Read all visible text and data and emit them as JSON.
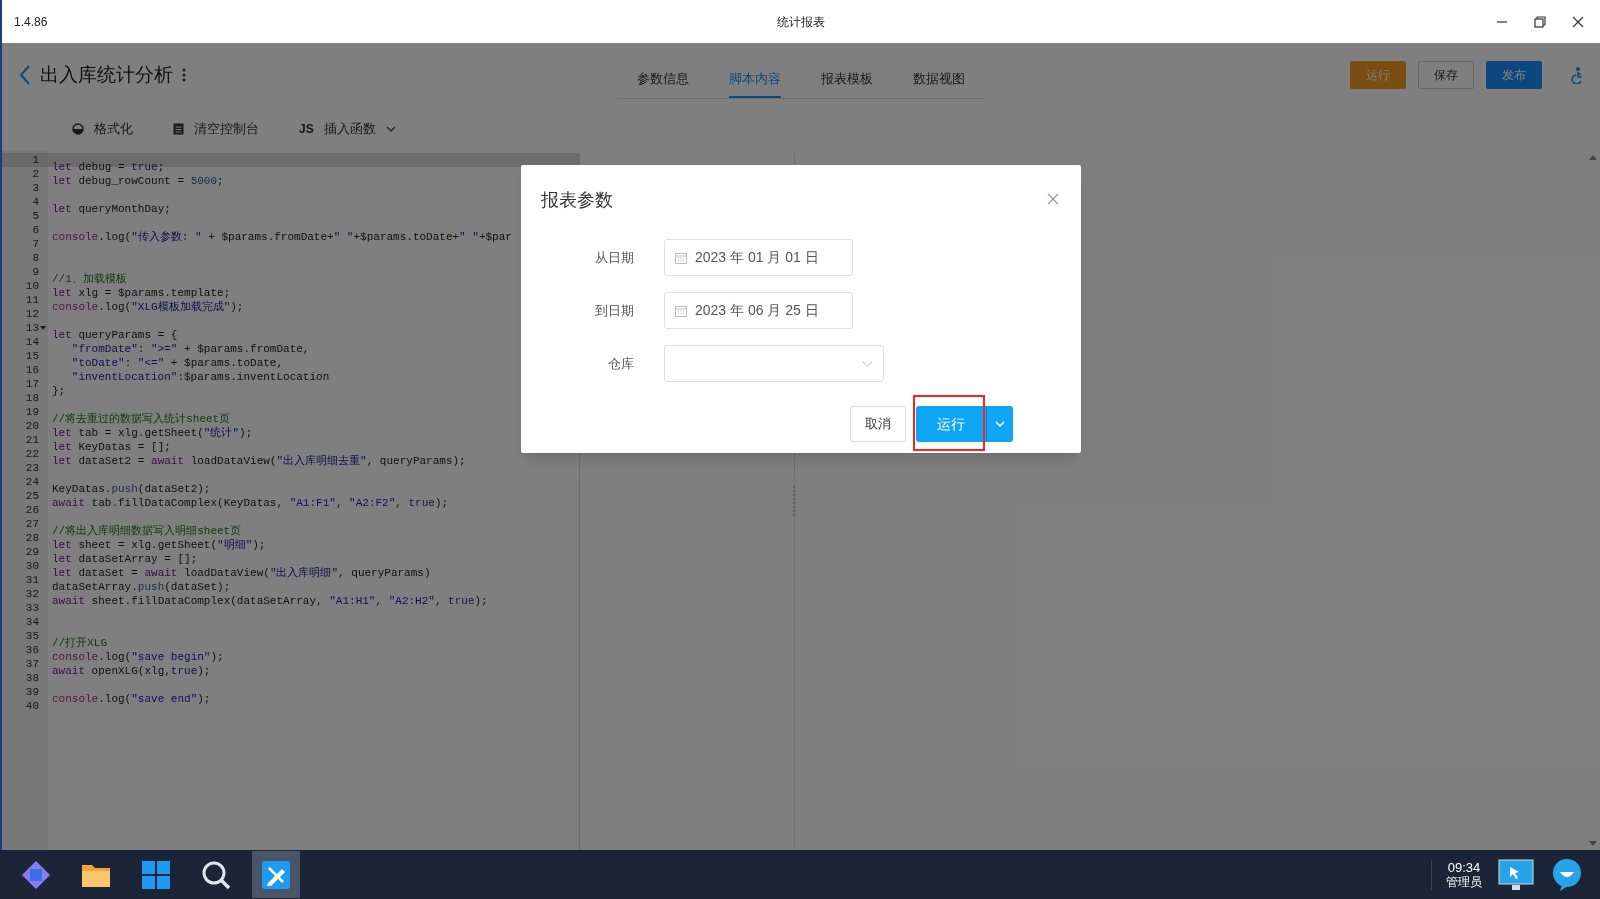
{
  "window": {
    "version": "1.4.86",
    "title": "统计报表"
  },
  "header": {
    "title": "出入库统计分析",
    "tabs": [
      {
        "label": "参数信息",
        "selected": false
      },
      {
        "label": "脚本内容",
        "selected": true
      },
      {
        "label": "报表模板",
        "selected": false
      },
      {
        "label": "数据视图",
        "selected": false
      }
    ],
    "buttons": [
      {
        "kind": "run",
        "label": "运行"
      },
      {
        "kind": "save",
        "label": "保存"
      },
      {
        "kind": "publish",
        "label": "发布"
      }
    ]
  },
  "toolbar": [
    {
      "kind": "format",
      "label": "格式化"
    },
    {
      "kind": "clear",
      "label": "清空控制台"
    },
    {
      "kind": "insert",
      "prefix": "JS",
      "label": "插入函数"
    }
  ],
  "code": [
    {
      "n": "1",
      "fold": false,
      "active": true,
      "tokens": [
        {
          "kind": "kw",
          "t": "let"
        },
        {
          "kind": "p",
          "t": " debug = "
        },
        {
          "kind": "atom",
          "t": "true"
        },
        {
          "kind": "p",
          "t": ";"
        }
      ]
    },
    {
      "n": "2",
      "fold": false,
      "active": false,
      "tokens": [
        {
          "kind": "kw",
          "t": "let"
        },
        {
          "kind": "p",
          "t": " debug_rowCount = "
        },
        {
          "kind": "num",
          "t": "5000"
        },
        {
          "kind": "p",
          "t": ";"
        }
      ]
    },
    {
      "n": "3",
      "fold": false,
      "active": false
    },
    {
      "n": "4",
      "fold": false,
      "active": false,
      "tokens": [
        {
          "kind": "kw",
          "t": "let"
        },
        {
          "kind": "p",
          "t": " queryMonthDay;"
        }
      ]
    },
    {
      "n": "5",
      "fold": false,
      "active": false
    },
    {
      "n": "6",
      "fold": false,
      "active": false,
      "tokens": [
        {
          "kind": "builtin",
          "t": "console"
        },
        {
          "kind": "p",
          "t": ".log("
        },
        {
          "kind": "str",
          "t": "\"传入参数: \""
        },
        {
          "kind": "p",
          "t": " + $params.fromDate+"
        },
        {
          "kind": "str",
          "t": "\" \""
        },
        {
          "kind": "p",
          "t": "+$params.toDate+"
        },
        {
          "kind": "str",
          "t": "\" \""
        },
        {
          "kind": "p",
          "t": "+$par"
        }
      ]
    },
    {
      "n": "7",
      "fold": false,
      "active": false
    },
    {
      "n": "8",
      "fold": false,
      "active": false
    },
    {
      "n": "9",
      "fold": false,
      "active": false,
      "tokens": [
        {
          "kind": "com",
          "t": "//1、加载模板"
        }
      ]
    },
    {
      "n": "10",
      "fold": false,
      "active": false,
      "tokens": [
        {
          "kind": "kw",
          "t": "let"
        },
        {
          "kind": "p",
          "t": " xlg = $params.template;"
        }
      ]
    },
    {
      "n": "11",
      "fold": false,
      "active": false,
      "tokens": [
        {
          "kind": "builtin",
          "t": "console"
        },
        {
          "kind": "p",
          "t": ".log("
        },
        {
          "kind": "str",
          "t": "\"XLG模板加载完成\""
        },
        {
          "kind": "p",
          "t": ");"
        }
      ]
    },
    {
      "n": "12",
      "fold": false,
      "active": false
    },
    {
      "n": "13",
      "fold": true,
      "active": false,
      "tokens": [
        {
          "kind": "kw",
          "t": "let"
        },
        {
          "kind": "p",
          "t": " queryParams = {"
        }
      ]
    },
    {
      "n": "14",
      "fold": false,
      "active": false,
      "tokens": [
        {
          "kind": "str",
          "t": "   \"fromDate\""
        },
        {
          "kind": "p",
          "t": ": "
        },
        {
          "kind": "str",
          "t": "\">=\""
        },
        {
          "kind": "p",
          "t": " + $params.fromDate,"
        }
      ]
    },
    {
      "n": "15",
      "fold": false,
      "active": false,
      "tokens": [
        {
          "kind": "str",
          "t": "   \"toDate\""
        },
        {
          "kind": "p",
          "t": ": "
        },
        {
          "kind": "str",
          "t": "\"<=\""
        },
        {
          "kind": "p",
          "t": " + $params.toDate,"
        }
      ]
    },
    {
      "n": "16",
      "fold": false,
      "active": false,
      "tokens": [
        {
          "kind": "str",
          "t": "   \"inventLocation\""
        },
        {
          "kind": "p",
          "t": ":$params.inventLocation"
        }
      ]
    },
    {
      "n": "17",
      "fold": false,
      "active": false,
      "tokens": [
        {
          "kind": "p",
          "t": "};"
        }
      ]
    },
    {
      "n": "18",
      "fold": false,
      "active": false
    },
    {
      "n": "19",
      "fold": false,
      "active": false,
      "tokens": [
        {
          "kind": "com",
          "t": "//将去重过的数据写入统计sheet页"
        }
      ]
    },
    {
      "n": "20",
      "fold": false,
      "active": false,
      "tokens": [
        {
          "kind": "kw",
          "t": "let"
        },
        {
          "kind": "p",
          "t": " tab = xlg.getSheet("
        },
        {
          "kind": "str",
          "t": "\"统计\""
        },
        {
          "kind": "p",
          "t": ");"
        }
      ]
    },
    {
      "n": "21",
      "fold": false,
      "active": false,
      "tokens": [
        {
          "kind": "kw",
          "t": "let"
        },
        {
          "kind": "p",
          "t": " KeyDatas = [];"
        }
      ]
    },
    {
      "n": "22",
      "fold": false,
      "active": false,
      "tokens": [
        {
          "kind": "kw",
          "t": "let"
        },
        {
          "kind": "p",
          "t": " dataSet2 = "
        },
        {
          "kind": "kw",
          "t": "await"
        },
        {
          "kind": "p",
          "t": " loadDataView("
        },
        {
          "kind": "str",
          "t": "\"出入库明细去重\""
        },
        {
          "kind": "p",
          "t": ", queryParams);"
        }
      ]
    },
    {
      "n": "23",
      "fold": false,
      "active": false
    },
    {
      "n": "24",
      "fold": false,
      "active": false,
      "tokens": [
        {
          "kind": "p",
          "t": "KeyDatas."
        },
        {
          "kind": "prop",
          "t": "push"
        },
        {
          "kind": "p",
          "t": "(dataSet2);"
        }
      ]
    },
    {
      "n": "25",
      "fold": false,
      "active": false,
      "tokens": [
        {
          "kind": "kw",
          "t": "await"
        },
        {
          "kind": "p",
          "t": " tab.fillDataComplex(KeyDatas, "
        },
        {
          "kind": "str",
          "t": "\"A1:F1\""
        },
        {
          "kind": "p",
          "t": ", "
        },
        {
          "kind": "str",
          "t": "\"A2:F2\""
        },
        {
          "kind": "p",
          "t": ", "
        },
        {
          "kind": "atom",
          "t": "true"
        },
        {
          "kind": "p",
          "t": ");"
        }
      ]
    },
    {
      "n": "26",
      "fold": false,
      "active": false
    },
    {
      "n": "27",
      "fold": false,
      "active": false,
      "tokens": [
        {
          "kind": "com",
          "t": "//将出入库明细数据写入明细sheet页"
        }
      ]
    },
    {
      "n": "28",
      "fold": false,
      "active": false,
      "tokens": [
        {
          "kind": "kw",
          "t": "let"
        },
        {
          "kind": "p",
          "t": " sheet = xlg.getSheet("
        },
        {
          "kind": "str",
          "t": "\"明细\""
        },
        {
          "kind": "p",
          "t": ");"
        }
      ]
    },
    {
      "n": "29",
      "fold": false,
      "active": false,
      "tokens": [
        {
          "kind": "kw",
          "t": "let"
        },
        {
          "kind": "p",
          "t": " dataSetArray = [];"
        }
      ]
    },
    {
      "n": "30",
      "fold": false,
      "active": false,
      "tokens": [
        {
          "kind": "kw",
          "t": "let"
        },
        {
          "kind": "p",
          "t": " dataSet = "
        },
        {
          "kind": "kw",
          "t": "await"
        },
        {
          "kind": "p",
          "t": " loadDataView("
        },
        {
          "kind": "str",
          "t": "\"出入库明细\""
        },
        {
          "kind": "p",
          "t": ", queryParams)"
        }
      ]
    },
    {
      "n": "31",
      "fold": false,
      "active": false,
      "tokens": [
        {
          "kind": "p",
          "t": "dataSetArray."
        },
        {
          "kind": "prop",
          "t": "push"
        },
        {
          "kind": "p",
          "t": "(dataSet);"
        }
      ]
    },
    {
      "n": "32",
      "fold": false,
      "active": false,
      "tokens": [
        {
          "kind": "kw",
          "t": "await"
        },
        {
          "kind": "p",
          "t": " sheet.fillDataComplex(dataSetArray, "
        },
        {
          "kind": "str",
          "t": "\"A1:H1\""
        },
        {
          "kind": "p",
          "t": ", "
        },
        {
          "kind": "str",
          "t": "\"A2:H2\""
        },
        {
          "kind": "p",
          "t": ", "
        },
        {
          "kind": "atom",
          "t": "true"
        },
        {
          "kind": "p",
          "t": ");"
        }
      ]
    },
    {
      "n": "33",
      "fold": false,
      "active": false
    },
    {
      "n": "34",
      "fold": false,
      "active": false
    },
    {
      "n": "35",
      "fold": false,
      "active": false,
      "tokens": [
        {
          "kind": "com",
          "t": "//打开XLG"
        }
      ]
    },
    {
      "n": "36",
      "fold": false,
      "active": false,
      "tokens": [
        {
          "kind": "builtin",
          "t": "console"
        },
        {
          "kind": "p",
          "t": ".log("
        },
        {
          "kind": "str",
          "t": "\"save begin\""
        },
        {
          "kind": "p",
          "t": ");"
        }
      ]
    },
    {
      "n": "37",
      "fold": false,
      "active": false,
      "tokens": [
        {
          "kind": "kw",
          "t": "await"
        },
        {
          "kind": "p",
          "t": " openXLG(xlg,"
        },
        {
          "kind": "atom",
          "t": "true"
        },
        {
          "kind": "p",
          "t": ");"
        }
      ]
    },
    {
      "n": "38",
      "fold": false,
      "active": false
    },
    {
      "n": "39",
      "fold": false,
      "active": false,
      "tokens": [
        {
          "kind": "builtin",
          "t": "console"
        },
        {
          "kind": "p",
          "t": ".log("
        },
        {
          "kind": "str",
          "t": "\"save end\""
        },
        {
          "kind": "p",
          "t": ");"
        }
      ]
    },
    {
      "n": "40",
      "fold": false,
      "active": false
    }
  ],
  "dialog": {
    "title": "报表参数",
    "fields": [
      {
        "kind": "date",
        "label": "从日期",
        "value": "2023 年 01 月 01 日"
      },
      {
        "kind": "date",
        "label": "到日期",
        "value": "2023 年 06 月 25 日"
      },
      {
        "kind": "select",
        "label": "仓库"
      }
    ],
    "cancel": "取消",
    "run": {
      "label": "运行",
      "highlighted": true
    }
  },
  "taskbar": {
    "items": [
      {
        "kind": "logo",
        "selected": false
      },
      {
        "kind": "folder",
        "selected": false
      },
      {
        "kind": "windows",
        "selected": false
      },
      {
        "kind": "search",
        "selected": false
      },
      {
        "kind": "app",
        "selected": true
      }
    ],
    "time": "09:34",
    "user": "管理员"
  }
}
